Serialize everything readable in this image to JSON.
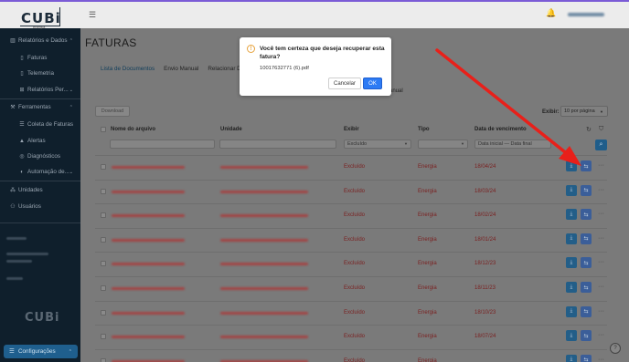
{
  "sidebar": {
    "items": [
      {
        "label": "Relatórios e Dados",
        "icon": "chart-icon",
        "chev": "⌃"
      },
      {
        "label": "Faturas",
        "icon": "document-icon"
      },
      {
        "label": "Telemetria",
        "icon": "document-icon"
      },
      {
        "label": "Relatórios Per...",
        "icon": "grid-icon",
        "chev": "⌄"
      },
      {
        "label": "Ferramentas",
        "icon": "wrench-icon",
        "chev": "⌃"
      },
      {
        "label": "Coleta de Faturas",
        "icon": "list-icon"
      },
      {
        "label": "Alertas",
        "icon": "alert-icon"
      },
      {
        "label": "Diagnósticos",
        "icon": "eye-icon"
      },
      {
        "label": "Automação de...",
        "icon": "toggle-icon",
        "chev": "⌄"
      },
      {
        "label": "Unidades",
        "icon": "network-icon"
      },
      {
        "label": "Usuários",
        "icon": "user-icon"
      }
    ],
    "config_label": "Configurações",
    "logo_text": "CUBi",
    "logo_sub": "energia"
  },
  "page": {
    "title": "FATURAS",
    "tabs": [
      "Lista de Documentos",
      "Envio Manual",
      "Relacionar Do"
    ],
    "subtab_right": "anual",
    "download_label": "Download",
    "exibir_label": "Exibir:",
    "page_size": "10 por página"
  },
  "table": {
    "headers": [
      "Nome do arquivo",
      "Unidade",
      "Exibir",
      "Tipo",
      "Data de vencimento"
    ],
    "filter_exibir": "Excluído",
    "filter_date_start": "Data inicial",
    "filter_date_sep": "—",
    "filter_date_end": "Data final",
    "rows": [
      {
        "exibir": "Excluído",
        "tipo": "Energia",
        "data": "18/04/24"
      },
      {
        "exibir": "Excluído",
        "tipo": "Energia",
        "data": "18/03/24"
      },
      {
        "exibir": "Excluído",
        "tipo": "Energia",
        "data": "18/02/24"
      },
      {
        "exibir": "Excluído",
        "tipo": "Energia",
        "data": "18/01/24"
      },
      {
        "exibir": "Excluído",
        "tipo": "Energia",
        "data": "18/12/23"
      },
      {
        "exibir": "Excluído",
        "tipo": "Energia",
        "data": "18/11/23"
      },
      {
        "exibir": "Excluído",
        "tipo": "Energia",
        "data": "18/10/23"
      },
      {
        "exibir": "Excluído",
        "tipo": "Energia",
        "data": "18/07/24"
      },
      {
        "exibir": "Excluído",
        "tipo": "Energia",
        "data": ""
      }
    ]
  },
  "modal": {
    "title": "Você tem certeza que deseja recuperar esta fatura?",
    "filename": "10017632771 (6).pdf",
    "cancel_label": "Cancelar",
    "ok_label": "OK"
  },
  "colors": {
    "accent": "#2d7bf4",
    "annotation_arrow": "#e8201a",
    "sidebar_bg": "#0f1f2c"
  }
}
